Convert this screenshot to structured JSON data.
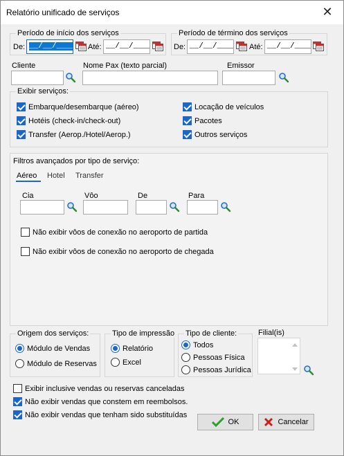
{
  "window": {
    "title": "Relatório unificado de serviços",
    "close_glyph": "✕"
  },
  "periodo_inicio": {
    "label": "Período de início dos serviços",
    "de_label": "De:",
    "de_value": "__/__/____",
    "ate_label": "Até:",
    "ate_value": "__/__/____"
  },
  "periodo_termino": {
    "label": "Período de término dos serviços",
    "de_label": "De:",
    "de_value": "__/__/____",
    "ate_label": "Até:",
    "ate_value": "__/__/____"
  },
  "fields": {
    "cliente_label": "Cliente",
    "nome_pax_label": "Nome Pax (texto parcial)",
    "emissor_label": "Emissor"
  },
  "exibir_servicos": {
    "label": "Exibir serviços:",
    "items": [
      {
        "label": "Embarque/desembarque (aéreo)",
        "checked": true
      },
      {
        "label": "Hotéis (check-in/check-out)",
        "checked": true
      },
      {
        "label": "Transfer (Aerop./Hotel/Aerop.)",
        "checked": true
      },
      {
        "label": "Locação de veículos",
        "checked": true
      },
      {
        "label": "Pacotes",
        "checked": true
      },
      {
        "label": "Outros serviços",
        "checked": true
      }
    ]
  },
  "filtros": {
    "label": "Filtros avançados por tipo de serviço:",
    "tabs": [
      "Aéreo",
      "Hotel",
      "Transfer"
    ],
    "active_tab": "Aéreo",
    "cia_label": "Cia",
    "voo_label": "Vôo",
    "de_label": "De",
    "para_label": "Para",
    "options": [
      {
        "label": "Não exibir vôos de conexão no aeroporto de partida",
        "checked": false
      },
      {
        "label": "Não exibir vôos de conexão no aeroporto de chegada",
        "checked": false
      }
    ]
  },
  "origem": {
    "label": "Origem dos serviços:",
    "options": [
      "Módulo de Vendas",
      "Módulo de Reservas"
    ],
    "selected": "Módulo de Vendas"
  },
  "impressao": {
    "label": "Tipo de impressão",
    "options": [
      "Relatório",
      "Excel"
    ],
    "selected": "Relatório"
  },
  "cliente_tipo": {
    "label": "Tipo de cliente:",
    "options": [
      "Todos",
      "Pessoas Física",
      "Pessoas Jurídica"
    ],
    "selected": "Todos"
  },
  "filial": {
    "label": "Filial(is)"
  },
  "bottom_options": [
    {
      "label": "Exibir inclusive vendas ou reservas canceladas",
      "checked": false
    },
    {
      "label": "Não exibir vendas que constem em reembolsos.",
      "checked": true
    },
    {
      "label": "Não exibir vendas que tenham sido substituídas",
      "checked": true
    }
  ],
  "buttons": {
    "ok": "OK",
    "cancel": "Cancelar"
  },
  "colors": {
    "accent": "#1a66c9",
    "ok_green": "#2e9e2e",
    "cancel_red": "#c81e1e"
  }
}
